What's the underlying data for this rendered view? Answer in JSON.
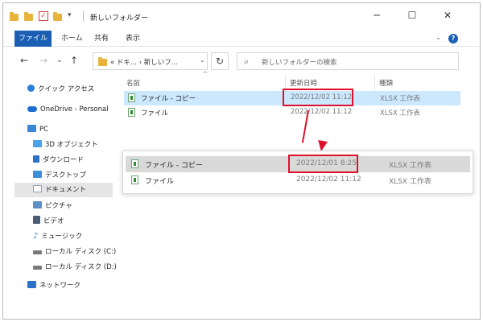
{
  "window": {
    "title": "新しいフォルダー",
    "controls": {
      "minimize": "─",
      "maximize": "☐",
      "close": "✕"
    }
  },
  "ribbon": {
    "tabs": [
      "ファイル",
      "ホーム",
      "共有",
      "表示"
    ],
    "expand_glyph": "⌄",
    "help_glyph": "?"
  },
  "navigation": {
    "back": "←",
    "forward": "→",
    "recent": "⌄",
    "up": "↑",
    "address": "« ドキ... › 新しいフ...",
    "address_dropdown": "⌄",
    "refresh": "↻",
    "search_placeholder": "新しいフォルダーの検索"
  },
  "sidebar": {
    "items": [
      {
        "label": "クイック アクセス",
        "icon": "star-icon",
        "color": "#2b7fd8"
      },
      {
        "label": "OneDrive - Personal",
        "icon": "cloud-icon",
        "color": "#1f6fd1"
      },
      {
        "label": "PC",
        "icon": "computer-icon",
        "color": "#3a86d6"
      },
      {
        "label": "3D オブジェクト",
        "icon": "cube-icon",
        "color": "#4aa3e8"
      },
      {
        "label": "ダウンロード",
        "icon": "download-icon",
        "color": "#2a72c8"
      },
      {
        "label": "デスクトップ",
        "icon": "desktop-icon",
        "color": "#3c8fd9"
      },
      {
        "label": "ドキュメント",
        "icon": "document-icon",
        "color": "#8aa0b8",
        "selected": true
      },
      {
        "label": "ピクチャ",
        "icon": "pictures-icon",
        "color": "#5b8fc6"
      },
      {
        "label": "ビデオ",
        "icon": "video-icon",
        "color": "#4a5b74"
      },
      {
        "label": "ミュージック",
        "icon": "music-icon",
        "color": "#2a7ad1"
      },
      {
        "label": "ローカル ディスク (C:)",
        "icon": "drive-c-icon",
        "color": "#7a7a7a"
      },
      {
        "label": "ローカル ディスク (D:)",
        "icon": "drive-d-icon",
        "color": "#7a7a7a"
      },
      {
        "label": "ネットワーク",
        "icon": "network-icon",
        "color": "#2a72c8"
      }
    ]
  },
  "file_list": {
    "columns": [
      "名前",
      "更新日時",
      "種類"
    ],
    "sort_glyph": "^",
    "rows": [
      {
        "name": "ファイル - コピー",
        "modified": "2022/12/02 11:12",
        "type": "XLSX 工作表",
        "selected": true
      },
      {
        "name": "ファイル",
        "modified": "2022/12/02 11:12",
        "type": "XLSX 工作表"
      }
    ]
  },
  "zoom_popup": {
    "rows": [
      {
        "name": "ファイル - コピー",
        "modified": "2022/12/01 8:25",
        "type": "XLSX 工作表"
      },
      {
        "name": "ファイル",
        "modified": "2022/12/02 11:12",
        "type": "XLSX 工作表"
      }
    ]
  },
  "colors": {
    "accent": "#1a5fb4",
    "selection": "#cce8ff",
    "highlight": "#e0102a",
    "excel": "#2e8b2e"
  }
}
